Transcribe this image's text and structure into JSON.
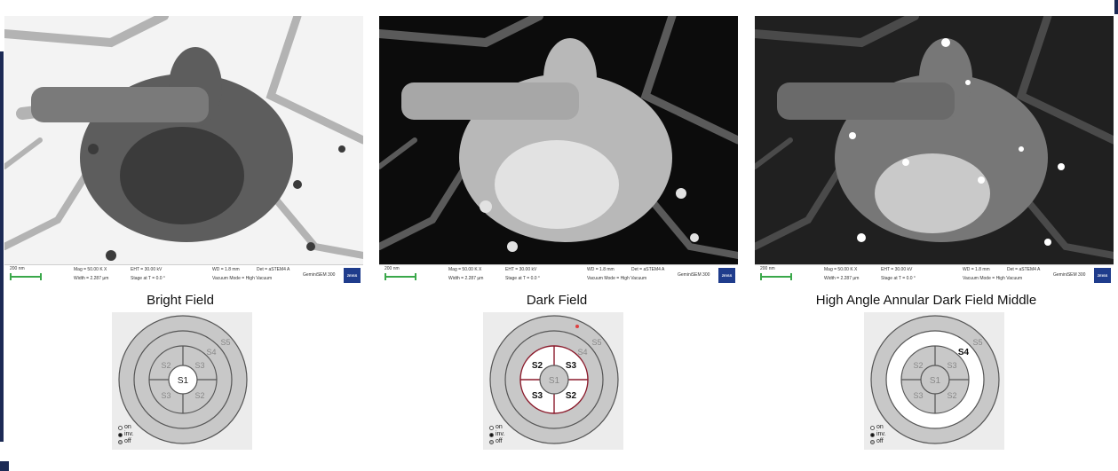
{
  "panels": [
    {
      "caption": "Bright Field",
      "mode": "bright"
    },
    {
      "caption": "Dark Field",
      "mode": "dark"
    },
    {
      "caption": "High Angle Annular Dark Field Middle",
      "mode": "haadf"
    }
  ],
  "databar": {
    "scale": "200 nm",
    "mag": "Mag =  50.00 K X",
    "width": "Width = 2.287 µm",
    "eht": "EHT = 30.00 kV",
    "stage": "Stage at T =  0.0 °",
    "wd": "WD =  1.8 mm",
    "det": "Det =  aSTEM4 A",
    "vac": "Vacuum Mode = High Vacuum",
    "model": "GeminiSEM 300",
    "logo": "ZEISS"
  },
  "detector": {
    "labels": {
      "s1": "S1",
      "s2": "S2",
      "s3": "S3",
      "s4": "S4",
      "s5": "S5"
    },
    "legend": [
      "on",
      "inv.",
      "off"
    ]
  },
  "colors": {
    "ring_gray": "#c8c8c8",
    "ring_white": "#ffffff",
    "accent": "#1c2a55",
    "scalebar": "#3aa84a",
    "highlight_dot": "#e04040"
  }
}
